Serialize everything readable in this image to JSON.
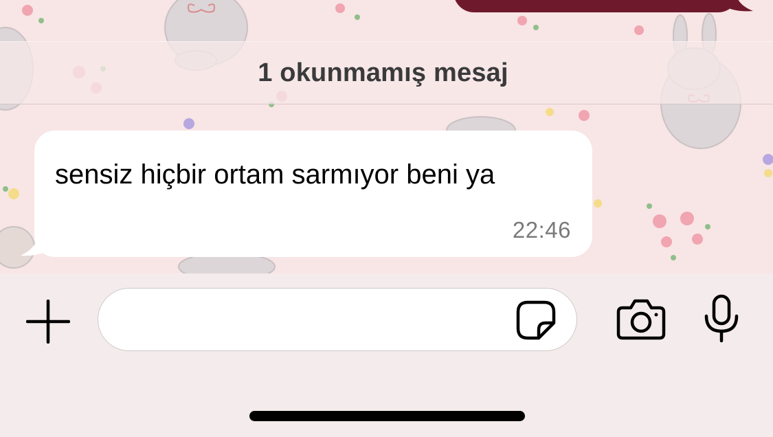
{
  "banner": {
    "unread_label": "1 okunmamış mesaj"
  },
  "message": {
    "text": "sensiz hiçbir ortam sarmıyor beni ya",
    "time": "22:46"
  },
  "input": {
    "placeholder": ""
  },
  "icons": {
    "plus": "plus-icon",
    "sticker": "sticker-icon",
    "camera": "camera-icon",
    "mic": "microphone-icon"
  },
  "colors": {
    "outgoing_bubble": "#6f1a2c",
    "incoming_bubble": "#ffffff",
    "wallpaper": "#f8e5e5"
  }
}
